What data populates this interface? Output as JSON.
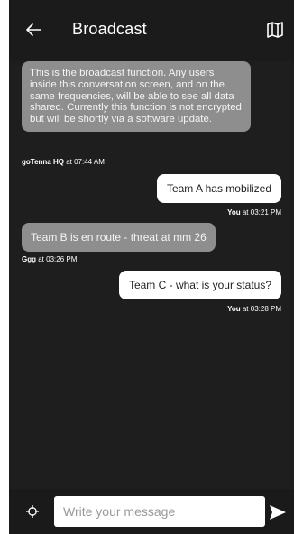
{
  "header": {
    "title": "Broadcast",
    "back_icon": "arrow-left-icon",
    "map_icon": "map-icon"
  },
  "messages": [
    {
      "direction": "incoming",
      "text": "This is the broadcast function. Any users inside this conversation screen, and on the same frequencies, will be able to see all data shared. Currently this function is not encrypted but will be shortly via a software update.",
      "sender": "goTenna HQ",
      "time": "at 07:44 AM"
    },
    {
      "direction": "outgoing",
      "text": "Team A has mobilized",
      "sender": "You",
      "time": "at 03:21 PM"
    },
    {
      "direction": "incoming",
      "text": "Team B is en route - threat at mm 26",
      "sender": "Ggg",
      "time": "at 03:26 PM"
    },
    {
      "direction": "outgoing",
      "text": "Team C - what is your status?",
      "sender": "You",
      "time": "at 03:28 PM"
    }
  ],
  "composer": {
    "placeholder": "Write your message",
    "value": "",
    "location_icon": "crosshair-icon",
    "send_icon": "send-icon"
  },
  "colors": {
    "background": "#1e1e1e",
    "incoming_bubble": "#8e8e8e",
    "outgoing_bubble": "#ffffff"
  }
}
